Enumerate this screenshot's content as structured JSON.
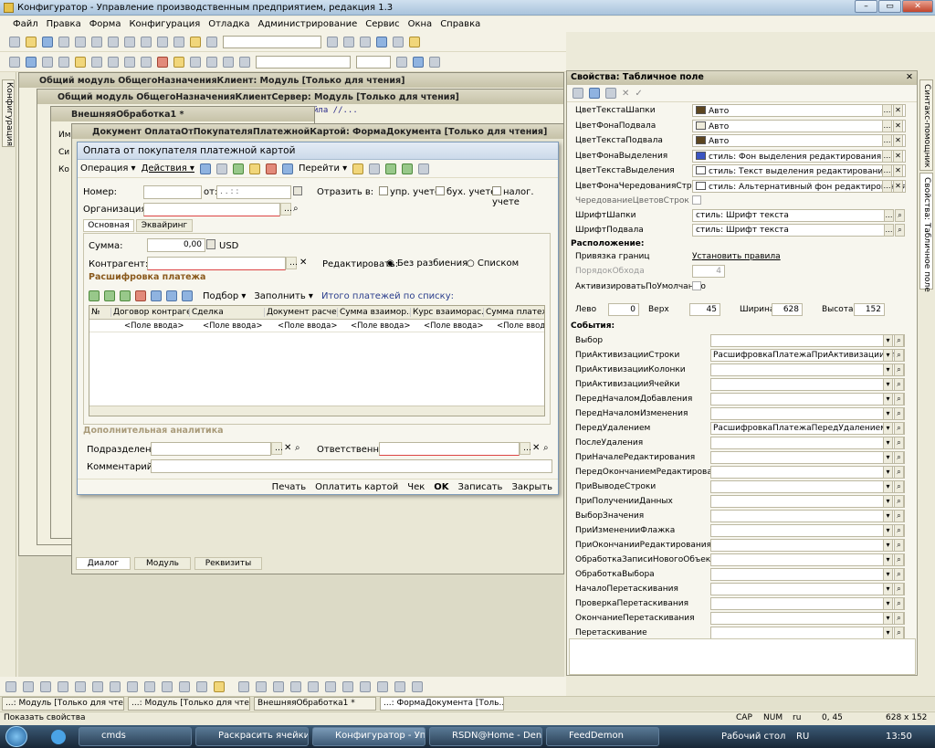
{
  "app": {
    "title": "Конфигуратор - Управление производственным предприятием, редакция 1.3",
    "controls": [
      "–",
      "▭",
      "✕"
    ]
  },
  "menu": [
    "Файл",
    "Правка",
    "Форма",
    "Конфигурация",
    "Отладка",
    "Администрирование",
    "Сервис",
    "Окна",
    "Справка"
  ],
  "left_panel_label": "Конфигурация",
  "right_panel": {
    "tab1": "Синтакс-помощник",
    "tab2": "Свойства: Табличное поле"
  },
  "windows": {
    "w1": "Общий модуль ОбщегоНазначенияКлиент: Модуль [Только для чтения]",
    "w2": "Общий модуль ОбщегоНазначенияКлиентСервер: Модуль [Только для чтения]",
    "w3": "ВнешняяОбработка1 *",
    "w4": "Документ ОплатаОтПокупателяПлатежнойКартой: ФормаДокумента [Только для чтения]",
    "code_snippet": "йла //...",
    "w3_side": [
      "Им",
      "Си",
      "Ко"
    ]
  },
  "form": {
    "title": "Оплата от покупателя платежной картой",
    "toolbar": {
      "operation": "Операция ▾",
      "actions": "Действия ▾",
      "goto": "Перейти ▾"
    },
    "number_label": "Номер:",
    "from_label": "от:",
    "date_placeholder": ". .  : :",
    "reflect_label": "Отразить в:",
    "chk_upr": "упр. учете",
    "chk_buh": "бух. учете",
    "chk_nal": "налог. учете",
    "org_label": "Организация:",
    "tab_main": "Основная",
    "tab_acq": "Эквайринг",
    "sum_label": "Сумма:",
    "sum_value": "0,00",
    "currency": "USD",
    "contractor_label": "Контрагент:",
    "edit_label": "Редактировать:",
    "radio_nosplit": "Без разбиения",
    "radio_list": "Списком",
    "breakdown_title": "Расшифровка платежа",
    "grid_toolbar": {
      "select": "Подбор ▾",
      "fill": "Заполнить ▾",
      "total": "Итого платежей по списку:"
    },
    "columns": [
      "№",
      "Договор контраге...",
      "Сделка",
      "Документ расче...",
      "Сумма взаимор...",
      "Курс взаиморас...",
      "Сумма платежа"
    ],
    "cell_value": "<Поле ввода>",
    "extra_title": "Дополнительная аналитика",
    "dept_label": "Подразделение:",
    "resp_label": "Ответственный:",
    "comment_label": "Комментарий:",
    "bottom_buttons": [
      "Печать",
      "Оплатить картой",
      "Чек",
      "OK",
      "Записать",
      "Закрыть"
    ]
  },
  "editor_tabs": [
    "Диалог",
    "Модуль",
    "Реквизиты"
  ],
  "props": {
    "title": "Свойства: Табличное поле",
    "color_rows": [
      {
        "label": "ЦветТекстаШапки",
        "value": "Авто",
        "swatch": "#5c4520"
      },
      {
        "label": "ЦветФонаПодвала",
        "value": "Авто",
        "swatch": "#efecdc"
      },
      {
        "label": "ЦветТекстаПодвала",
        "value": "Авто",
        "swatch": "#5c4520"
      },
      {
        "label": "ЦветФонаВыделения",
        "value": "стиль: Фон выделения редактирования",
        "swatch": "#3b55c2"
      },
      {
        "label": "ЦветТекстаВыделения",
        "value": "стиль: Текст выделения редактирования",
        "swatch": "#ffffff"
      },
      {
        "label": "ЦветФонаЧередованияСтрок",
        "value": "стиль: Альтернативный фон редактирования",
        "swatch": "#ffffff"
      }
    ],
    "alternation_label": "ЧередованиеЦветовСтрок",
    "font_rows": [
      {
        "label": "ШрифтШапки",
        "value": "стиль: Шрифт текста"
      },
      {
        "label": "ШрифтПодвала",
        "value": "стиль: Шрифт текста"
      }
    ],
    "layout_section": "Расположение:",
    "binding_label": "Привязка границ",
    "binding_link": "Установить правила",
    "tab_order_label": "ПорядокОбхода",
    "tab_order_value": "4",
    "activate_label": "АктивизироватьПоУмолчанию",
    "left_label": "Лево",
    "left_value": "0",
    "top_label": "Верх",
    "top_value": "45",
    "width_label": "Ширина",
    "width_value": "628",
    "height_label": "Высота",
    "height_value": "152",
    "events_section": "События:",
    "events": [
      {
        "label": "Выбор",
        "value": ""
      },
      {
        "label": "ПриАктивизацииСтроки",
        "value": "РасшифровкаПлатежаПриАктивизацииСтрок"
      },
      {
        "label": "ПриАктивизацииКолонки",
        "value": ""
      },
      {
        "label": "ПриАктивизацииЯчейки",
        "value": ""
      },
      {
        "label": "ПередНачаломДобавления",
        "value": ""
      },
      {
        "label": "ПередНачаломИзменения",
        "value": ""
      },
      {
        "label": "ПередУдалением",
        "value": "РасшифровкаПлатежаПередУдалением"
      },
      {
        "label": "ПослеУдаления",
        "value": ""
      },
      {
        "label": "ПриНачалеРедактирования",
        "value": ""
      },
      {
        "label": "ПередОкончаниемРедактирования",
        "value": ""
      },
      {
        "label": "ПриВыводеСтроки",
        "value": ""
      },
      {
        "label": "ПриПолученииДанных",
        "value": ""
      },
      {
        "label": "ВыборЗначения",
        "value": ""
      },
      {
        "label": "ПриИзмененииФлажка",
        "value": ""
      },
      {
        "label": "ПриОкончанииРедактирования",
        "value": ""
      },
      {
        "label": "ОбработкаЗаписиНовогоОбъекта",
        "value": ""
      },
      {
        "label": "ОбработкаВыбора",
        "value": ""
      },
      {
        "label": "НачалоПеретаскивания",
        "value": ""
      },
      {
        "label": "ПроверкаПеретаскивания",
        "value": ""
      },
      {
        "label": "ОкончаниеПеретаскивания",
        "value": ""
      },
      {
        "label": "Перетаскивание",
        "value": ""
      }
    ]
  },
  "window_tabs": [
    "...: Модуль [Только для чте...",
    "...: Модуль [Только для чте...",
    "ВнешняяОбработка1 *",
    "...: ФормаДокумента [Толь..."
  ],
  "status": {
    "text": "Показать свойства",
    "caps": "CAP",
    "num": "NUM",
    "lang": "ru",
    "pos": "0, 45",
    "size": "628 x 152"
  },
  "taskbar": {
    "items": [
      "cmds",
      "Раскрасить ячейки ...",
      "Конфигуратор - Упр...",
      "RSDN@Home - Deni...",
      "FeedDemon"
    ],
    "desktop": "Рабочий стол",
    "lang": "RU",
    "time": "13:50"
  }
}
